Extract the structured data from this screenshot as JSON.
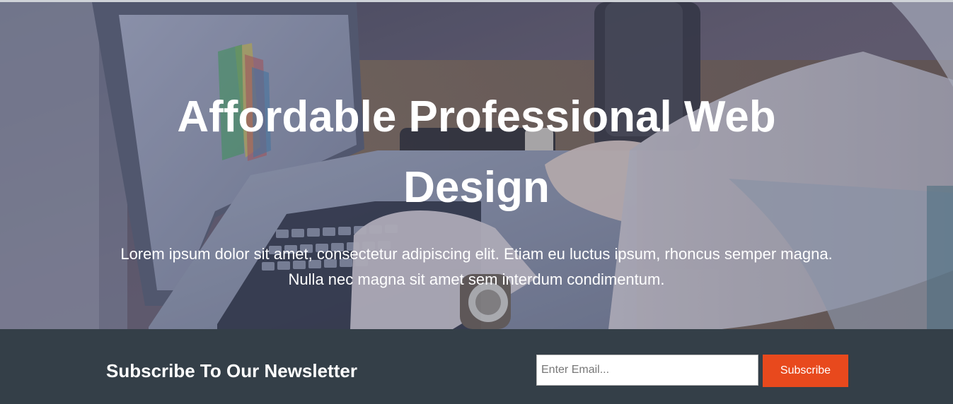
{
  "hero": {
    "title_line1": "Affordable Professional Web",
    "title_line2": "Design",
    "text": "Lorem ipsum dolor sit amet, consectetur adipiscing elit. Etiam eu luctus ipsum, rhoncus semper magna. Nulla nec magna sit amet sem interdum condimentum."
  },
  "newsletter": {
    "title": "Subscribe To Our Newsletter",
    "email_placeholder": "Enter Email...",
    "email_value": "",
    "button_label": "Subscribe"
  },
  "colors": {
    "newsletter_background": "#343f48",
    "accent": "#e8491d",
    "text_light": "#ffffff"
  }
}
